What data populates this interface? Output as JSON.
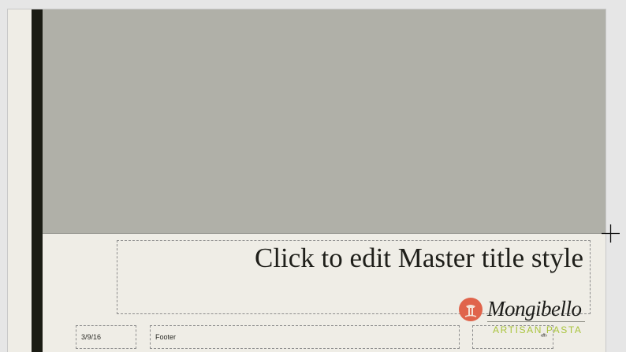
{
  "slide": {
    "title_placeholder": "Click to edit Master title style",
    "date": "3/9/16",
    "footer": "Footer",
    "slide_number": "‹#›"
  },
  "logo": {
    "name": "Mongibello",
    "tagline": "ARTISAN PASTA",
    "badge_color": "#e0644b",
    "tagline_color": "#a9c43c"
  },
  "colors": {
    "slide_background": "#efede6",
    "picture_area": "#b0b0a8",
    "left_band": "#1b1c14",
    "workspace": "#e6e6e6"
  },
  "icons": {
    "cursor": "crosshair-cursor-icon"
  }
}
